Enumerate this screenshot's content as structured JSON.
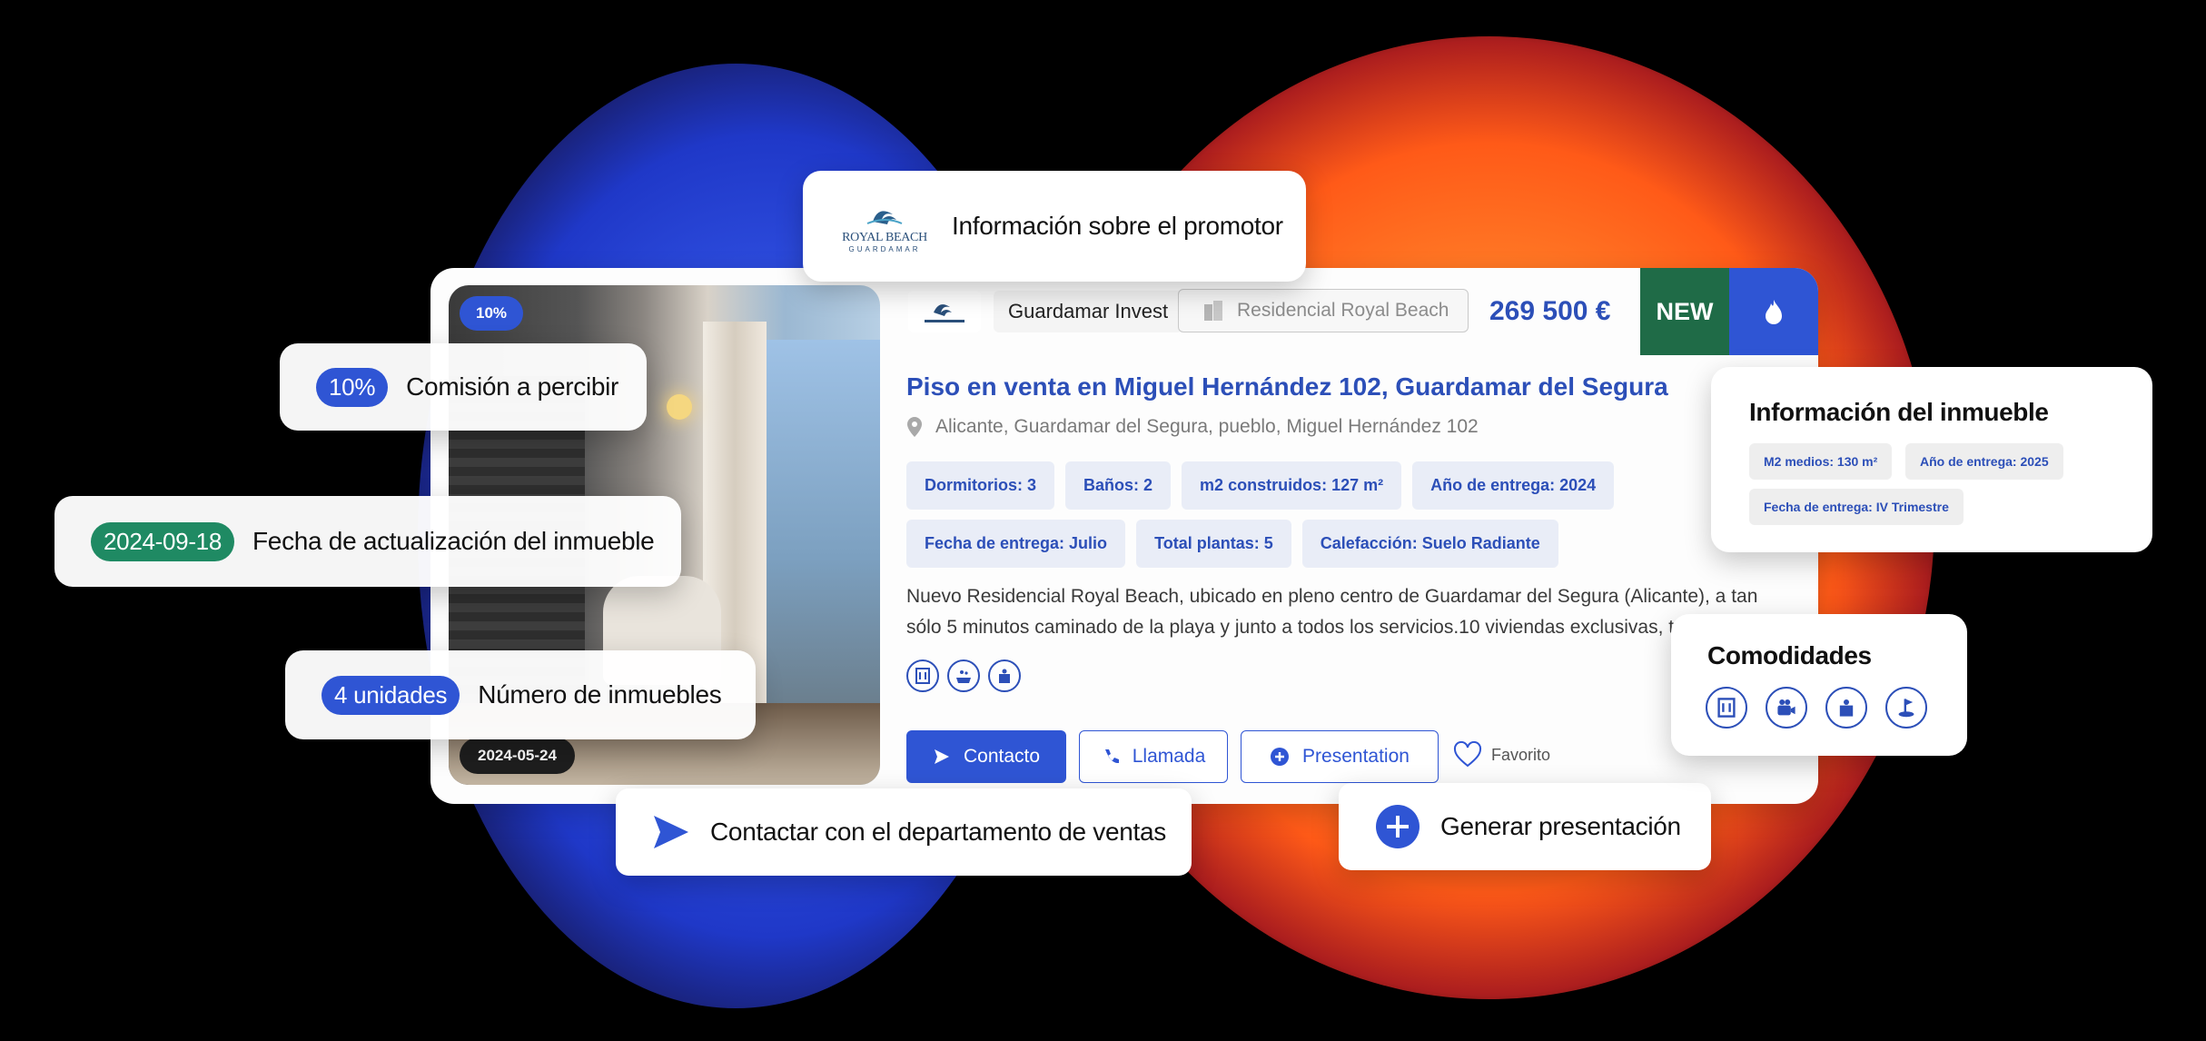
{
  "colors": {
    "accent_blue": "#2f55d4",
    "title_blue": "#2c4fb8",
    "new_green": "#1f6b47",
    "date_green": "#1f8a63",
    "blob_blue": "#2f4fe0",
    "blob_orange": "#ff7a26"
  },
  "listing": {
    "photo_badge": "10%",
    "photo_date": "2024-05-24",
    "promoter_name": "Guardamar Invest",
    "residencial": "Residencial Royal Beach",
    "price": "269 500 €",
    "new_label": "NEW",
    "title": "Piso en venta en Miguel Hernández 102, Guardamar del Segura",
    "address": "Alicante, Guardamar del Segura, pueblo, Miguel Hernández 102",
    "tags_row1": [
      "Dormitorios: 3",
      "Baños: 2",
      "m2 construidos: 127 m²",
      "Año de entrega: 2024"
    ],
    "tags_row2": [
      "Fecha de entrega: Julio",
      "Total plantas: 5",
      "Calefacción: Suelo Radiante"
    ],
    "description": "Nuevo Residencial Royal Beach, ubicado en pleno centro de Guardamar del Segura (Alicante), a tan sólo 5 minutos caminado de la playa y junto a todos los servicios.10 viviendas exclusivas, to...",
    "amenity_icons": [
      "building-icon",
      "pool-icon",
      "elevator-icon"
    ],
    "buttons": {
      "contact": "Contacto",
      "call": "Llamada",
      "presentation": "Presentation",
      "favorite": "Favorito"
    }
  },
  "callouts": {
    "promotor": "Información sobre el promotor",
    "promotor_logo_line1": "ROYAL BEACH",
    "promotor_logo_line2": "GUARDAMAR",
    "comision_value": "10%",
    "comision_label": "Comisión a percibir",
    "fecha_value": "2024-09-18",
    "fecha_label": "Fecha de actualización del inmueble",
    "unidades_value": "4 unidades",
    "unidades_label": "Número de inmuebles",
    "contactar": "Contactar con el departamento de ventas",
    "generar": "Generar presentación"
  },
  "info_inmueble": {
    "title": "Información del inmueble",
    "tags": [
      "M2 medios: 130 m²",
      "Año de entrega: 2025",
      "Fecha de entrega: IV Trimestre"
    ]
  },
  "comodidades": {
    "title": "Comodidades",
    "icons": [
      "building-icon",
      "camera-icon",
      "elevator-icon",
      "golf-icon"
    ]
  }
}
